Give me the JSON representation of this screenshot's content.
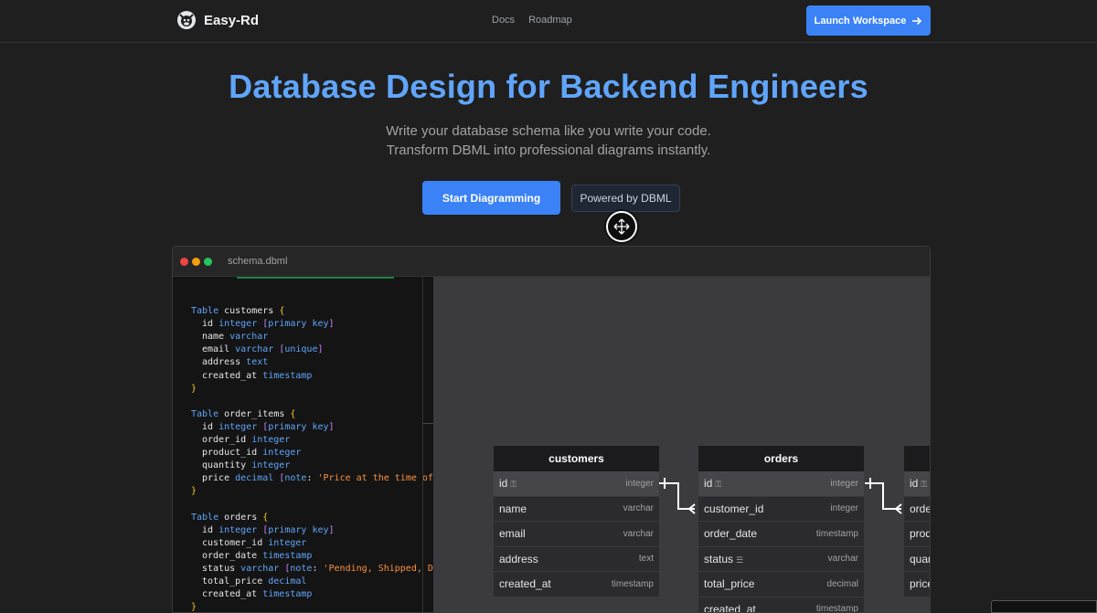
{
  "header": {
    "brand": "Easy-Rd",
    "nav": [
      "Docs",
      "Roadmap"
    ],
    "launch_label": "Launch Workspace"
  },
  "hero": {
    "title": "Database Design for Backend Engineers",
    "subtitle": "Write your database schema like you write your code. Transform DBML into professional diagrams instantly.",
    "primary_cta": "Start Diagramming",
    "secondary_cta": "Powered by DBML"
  },
  "editor": {
    "filename": "schema.dbml",
    "code": [
      {
        "kw": "Table",
        "name": "customers",
        "fields": [
          {
            "n": "id",
            "t": "integer",
            "a": "[primary key]"
          },
          {
            "n": "name",
            "t": "varchar"
          },
          {
            "n": "email",
            "t": "varchar",
            "a": "[unique]"
          },
          {
            "n": "address",
            "t": "text"
          },
          {
            "n": "created_at",
            "t": "timestamp"
          }
        ]
      },
      {
        "kw": "Table",
        "name": "order_items",
        "fields": [
          {
            "n": "id",
            "t": "integer",
            "a": "[primary key]"
          },
          {
            "n": "order_id",
            "t": "integer"
          },
          {
            "n": "product_id",
            "t": "integer"
          },
          {
            "n": "quantity",
            "t": "integer"
          },
          {
            "n": "price",
            "t": "decimal",
            "note": "[note: 'Price at the time of or"
          }
        ]
      },
      {
        "kw": "Table",
        "name": "orders",
        "fields": [
          {
            "n": "id",
            "t": "integer",
            "a": "[primary key]"
          },
          {
            "n": "customer_id",
            "t": "integer"
          },
          {
            "n": "order_date",
            "t": "timestamp"
          },
          {
            "n": "status",
            "t": "varchar",
            "note": "[note: 'Pending, Shipped, Deli"
          },
          {
            "n": "total_price",
            "t": "decimal"
          },
          {
            "n": "created_at",
            "t": "timestamp"
          }
        ]
      }
    ]
  },
  "diagram": {
    "tables": [
      {
        "name": "customers",
        "rows": [
          {
            "n": "id",
            "t": "integer",
            "pk": true
          },
          {
            "n": "name",
            "t": "varchar"
          },
          {
            "n": "email",
            "t": "varchar"
          },
          {
            "n": "address",
            "t": "text"
          },
          {
            "n": "created_at",
            "t": "timestamp"
          }
        ]
      },
      {
        "name": "orders",
        "rows": [
          {
            "n": "id",
            "t": "integer",
            "pk": true
          },
          {
            "n": "customer_id",
            "t": "integer"
          },
          {
            "n": "order_date",
            "t": "timestamp"
          },
          {
            "n": "status",
            "t": "varchar",
            "note": true
          },
          {
            "n": "total_price",
            "t": "decimal"
          },
          {
            "n": "created_at",
            "t": "timestamp"
          }
        ]
      },
      {
        "name": "",
        "rows": [
          {
            "n": "id",
            "t": "",
            "pk": true
          },
          {
            "n": "orde",
            "t": ""
          },
          {
            "n": "prod",
            "t": ""
          },
          {
            "n": "quan",
            "t": ""
          },
          {
            "n": "price",
            "t": ""
          }
        ]
      }
    ]
  },
  "colors": {
    "accent": "#3b82f6",
    "title": "#60a5fa",
    "background": "#1f1f1f"
  }
}
